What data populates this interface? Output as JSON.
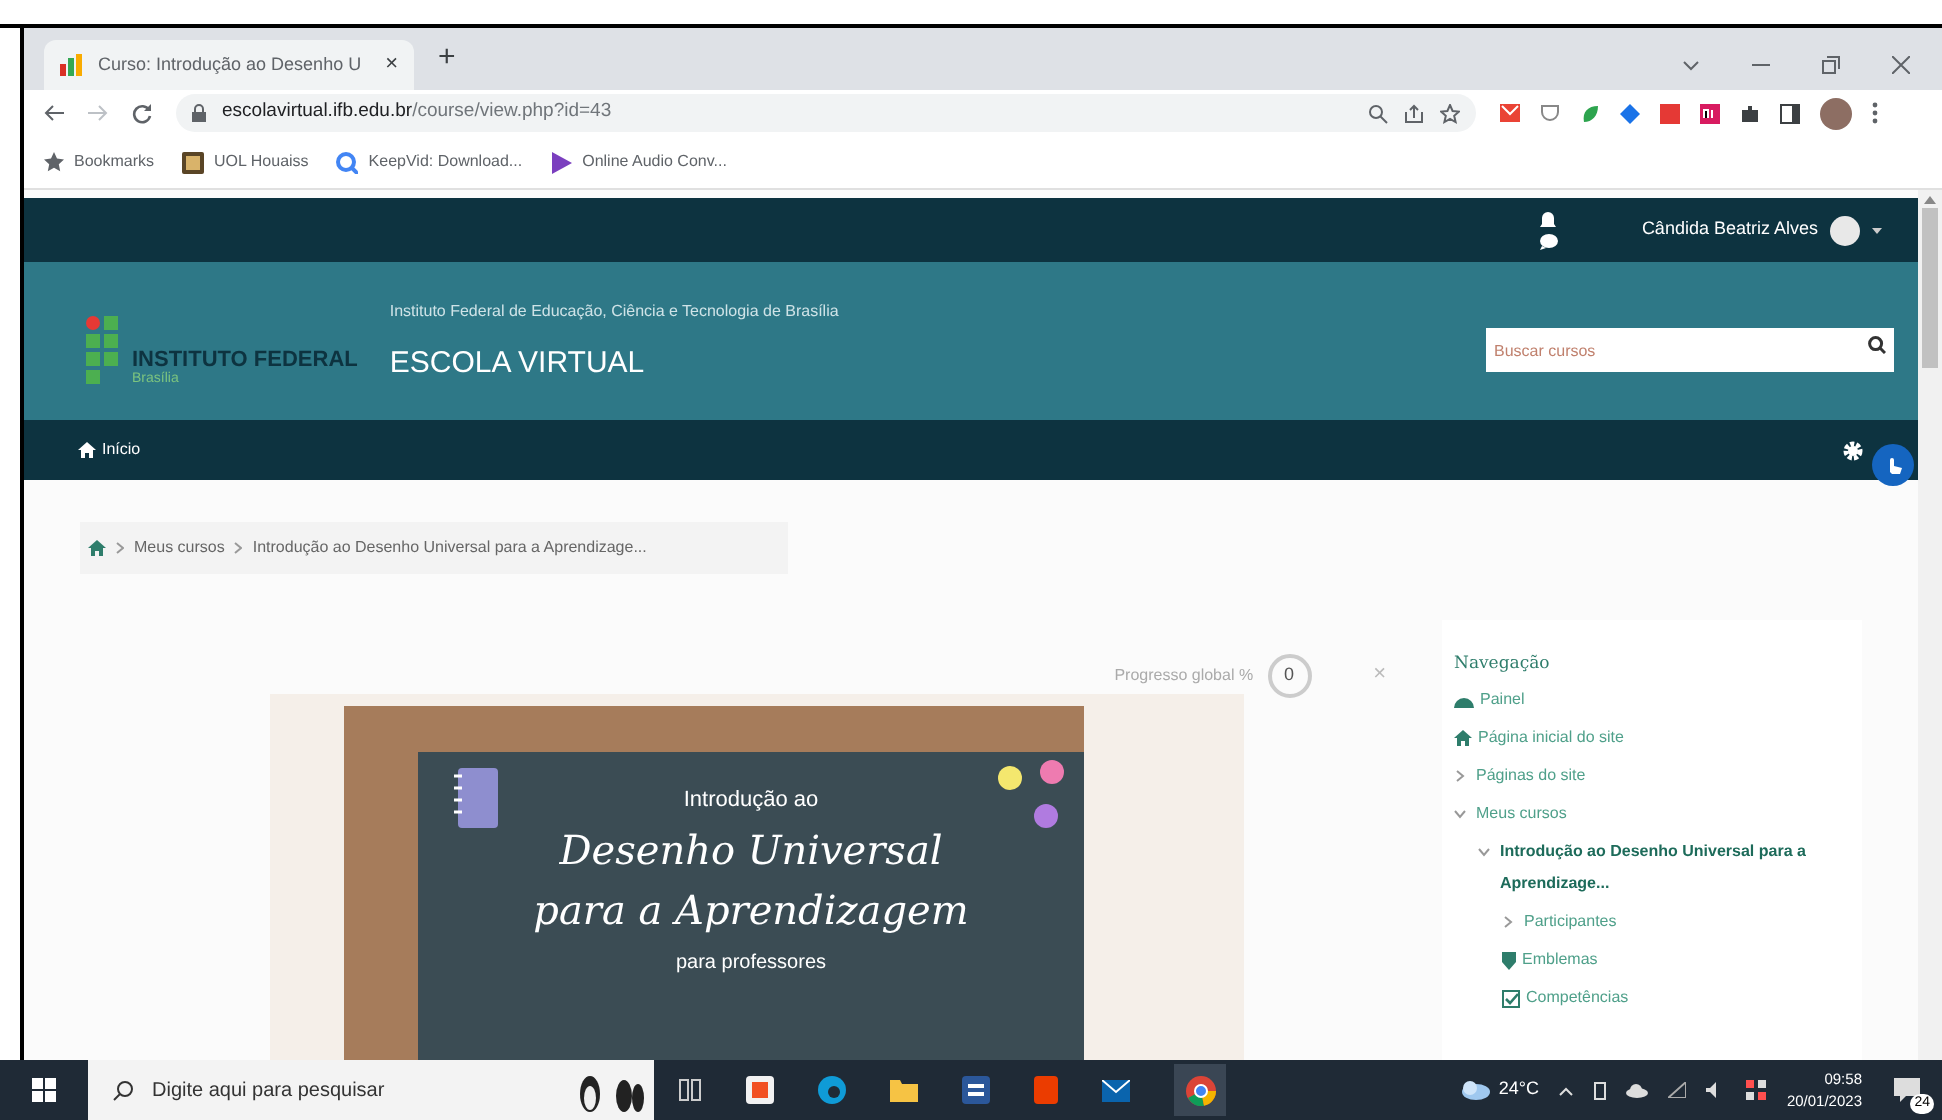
{
  "browser": {
    "tab": {
      "title": "Curso: Introdução ao Desenho U",
      "close": "×"
    },
    "new_tab": "+",
    "url_host": "escolavirtual.ifb.edu.br",
    "url_path": "/course/view.php?id=43",
    "bookmarks": [
      {
        "kind": "star",
        "label": "Bookmarks"
      },
      {
        "kind": "uol",
        "label": "UOL Houaiss"
      },
      {
        "kind": "keepvid",
        "label": "KeepVid: Download..."
      },
      {
        "kind": "audio",
        "label": "Online Audio Conv..."
      }
    ]
  },
  "page": {
    "user_name": "Cândida Beatriz Alves",
    "logo_title": "INSTITUTO FEDERAL",
    "logo_sub": "Brasília",
    "subtitle": "Instituto Federal de Educação, Ciência e Tecnologia de Brasília",
    "site_title": "ESCOLA VIRTUAL",
    "search": {
      "placeholder": "Buscar cursos"
    },
    "nav_home": "Início",
    "breadcrumb": [
      "Meus cursos",
      "Introdução ao Desenho Universal para a Aprendizage..."
    ],
    "progress": {
      "label": "Progresso global %",
      "value": "0",
      "close": "×"
    },
    "banner": {
      "lines": [
        "Introdução ao",
        "Desenho Universal",
        "para a Aprendizagem",
        "para professores"
      ]
    },
    "navigation": {
      "title": "Navegação",
      "items": [
        {
          "kind": "dashboard",
          "label": "Painel",
          "selected": false
        },
        {
          "kind": "home",
          "label": "Página inicial do site",
          "selected": false
        },
        {
          "kind": "branch",
          "label": "Páginas do site",
          "expanded": false,
          "selected": false
        },
        {
          "kind": "branch",
          "label": "Meus cursos",
          "expanded": true,
          "selected": false,
          "children": [
            {
              "kind": "branch",
              "label": "Introdução ao Desenho Universal para a Aprendizage...",
              "expanded": true,
              "selected": true,
              "children": [
                {
                  "kind": "branch",
                  "label": "Participantes",
                  "expanded": false,
                  "selected": false
                },
                {
                  "kind": "badges",
                  "label": "Emblemas",
                  "selected": false
                },
                {
                  "kind": "competencies",
                  "label": "Competências",
                  "selected": false
                }
              ]
            }
          ]
        }
      ]
    }
  },
  "taskbar": {
    "search": {
      "placeholder": "Digite aqui para pesquisar"
    },
    "weather": "24°C",
    "time": "09:58",
    "date": "20/01/2023",
    "notifications": "24"
  }
}
